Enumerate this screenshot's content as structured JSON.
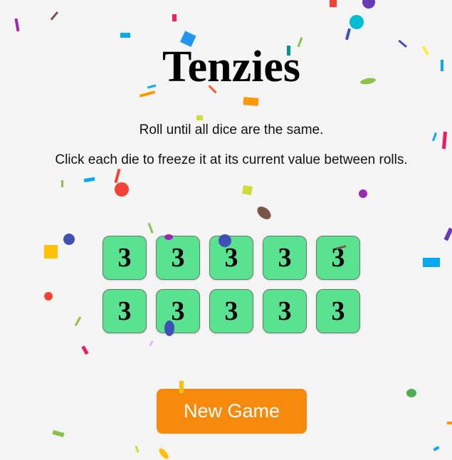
{
  "app": {
    "title": "Tenzies",
    "instructions": [
      "Roll until all dice are the same.",
      "Click each die to freeze it at its current value between rolls."
    ]
  },
  "dice": [
    {
      "value": "3"
    },
    {
      "value": "3"
    },
    {
      "value": "3"
    },
    {
      "value": "3"
    },
    {
      "value": "3"
    },
    {
      "value": "3"
    },
    {
      "value": "3"
    },
    {
      "value": "3"
    },
    {
      "value": "3"
    },
    {
      "value": "3"
    }
  ],
  "buttons": {
    "new_game": "New Game"
  },
  "colors": {
    "background": "#f5f5f5",
    "die_held": "#59e391",
    "button": "#f78a0c"
  },
  "effects": {
    "confetti": "celebration-confetti"
  }
}
